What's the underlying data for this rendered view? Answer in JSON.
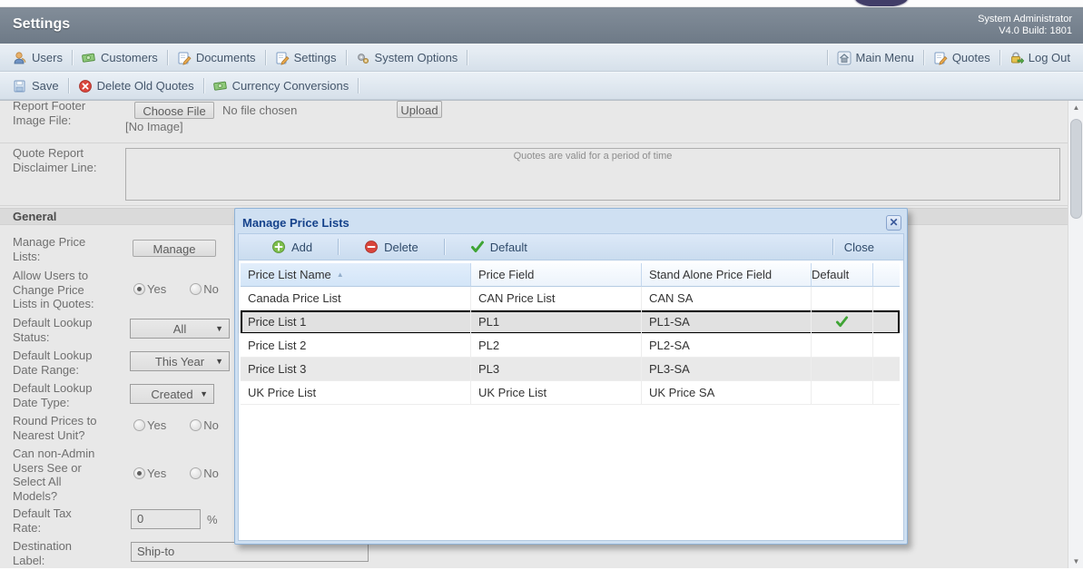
{
  "header": {
    "title": "Settings",
    "account_name": "System Administrator",
    "version": "V4.0 Build: 1801"
  },
  "nav": {
    "left": [
      {
        "label": "Users",
        "icon": "users-icon"
      },
      {
        "label": "Customers",
        "icon": "money-icon"
      },
      {
        "label": "Documents",
        "icon": "document-pencil-icon"
      },
      {
        "label": "Settings",
        "icon": "document-pencil-icon"
      },
      {
        "label": "System Options",
        "icon": "gears-icon"
      }
    ],
    "right": [
      {
        "label": "Main Menu",
        "icon": "home-icon"
      },
      {
        "label": "Quotes",
        "icon": "document-pencil-icon"
      },
      {
        "label": "Log Out",
        "icon": "lock-arrow-icon"
      }
    ]
  },
  "actions": [
    {
      "label": "Save",
      "icon": "save-icon"
    },
    {
      "label": "Delete Old Quotes",
      "icon": "red-x-circle-icon"
    },
    {
      "label": "Currency Conversions",
      "icon": "money-icon"
    }
  ],
  "icons": {
    "dropdown_caret": "▼",
    "sort_asc": "▲",
    "close_x": "✕",
    "scroll_up": "▲",
    "scroll_down": "▼"
  },
  "form": {
    "report_footer": {
      "label": "Report Footer\nImage File:",
      "choose_file_label": "Choose File",
      "file_status": "No file chosen",
      "upload_label": "Upload",
      "no_image_text": "[No Image]"
    },
    "disclaimer": {
      "label": "Quote Report\nDisclaimer Line:",
      "value": "Quotes are valid for a period of time"
    },
    "section_title": "General",
    "manage_price_lists": {
      "label": "Manage Price\nLists:",
      "button_label": "Manage"
    },
    "radio_labels": {
      "yes": "Yes",
      "no": "No"
    },
    "allow_change": {
      "label": "Allow Users to\nChange Price\nLists in Quotes:",
      "selected": "yes"
    },
    "lookup_status": {
      "label": "Default Lookup\nStatus:",
      "value": "All"
    },
    "lookup_date_range": {
      "label": "Default Lookup\nDate Range:",
      "value": "This Year"
    },
    "lookup_date_type": {
      "label": "Default Lookup\nDate Type:",
      "value": "Created"
    },
    "round_prices": {
      "label": "Round Prices to\nNearest Unit?",
      "selected": ""
    },
    "non_admin": {
      "label": "Can non-Admin\nUsers See or\nSelect All\nModels?",
      "selected": "yes"
    },
    "tax_rate": {
      "label": "Default Tax\nRate:",
      "value": "0",
      "suffix": "%"
    },
    "destination": {
      "label": "Destination\nLabel:",
      "value": "Ship-to"
    }
  },
  "modal": {
    "title": "Manage Price Lists",
    "toolbar": {
      "add": "Add",
      "delete": "Delete",
      "default": "Default",
      "close": "Close"
    },
    "table": {
      "columns": [
        "Price List Name",
        "Price Field",
        "Stand Alone Price Field",
        "Default"
      ],
      "sorted_column": 0,
      "sort_direction": "asc",
      "rows": [
        {
          "name": "Canada Price List",
          "price_field": "CAN Price List",
          "standalone_field": "CAN SA",
          "default": false,
          "selected": false
        },
        {
          "name": "Price List 1",
          "price_field": "PL1",
          "standalone_field": "PL1-SA",
          "default": true,
          "selected": true
        },
        {
          "name": "Price List 2",
          "price_field": "PL2",
          "standalone_field": "PL2-SA",
          "default": false,
          "selected": false
        },
        {
          "name": "Price List 3",
          "price_field": "PL3",
          "standalone_field": "PL3-SA",
          "default": false,
          "selected": false
        },
        {
          "name": "UK Price List",
          "price_field": "UK Price List",
          "standalone_field": "UK Price SA",
          "default": false,
          "selected": false
        }
      ]
    }
  }
}
